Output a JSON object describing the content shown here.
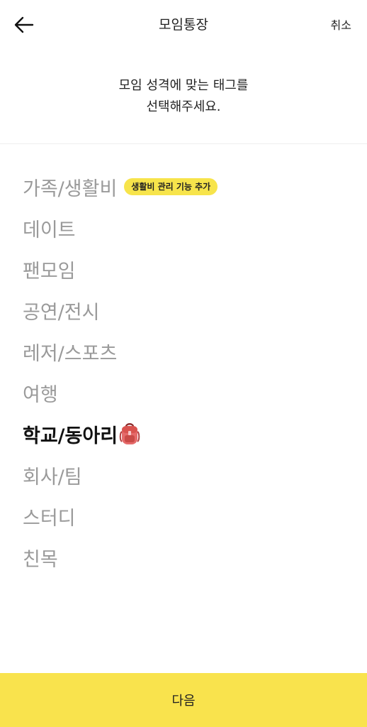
{
  "header": {
    "title": "모임통장",
    "cancel_label": "취소"
  },
  "prompt": {
    "line1": "모임 성격에 맞는 태그를",
    "line2": "선택해주세요."
  },
  "tags": [
    {
      "label": "가족/생활비",
      "badge": "생활비 관리 기능 추가"
    },
    {
      "label": "데이트"
    },
    {
      "label": "팬모임"
    },
    {
      "label": "공연/전시"
    },
    {
      "label": "레저/스포츠"
    },
    {
      "label": "여행"
    },
    {
      "label": "학교/동아리",
      "selected": true,
      "icon": "backpack-icon"
    },
    {
      "label": "회사/팀"
    },
    {
      "label": "스터디"
    },
    {
      "label": "친목"
    }
  ],
  "footer": {
    "next_label": "다음"
  },
  "colors": {
    "accent": "#f9e34d",
    "badge": "#f7e44b",
    "unselected_text": "#9a9a9a",
    "selected_text": "#111111"
  }
}
